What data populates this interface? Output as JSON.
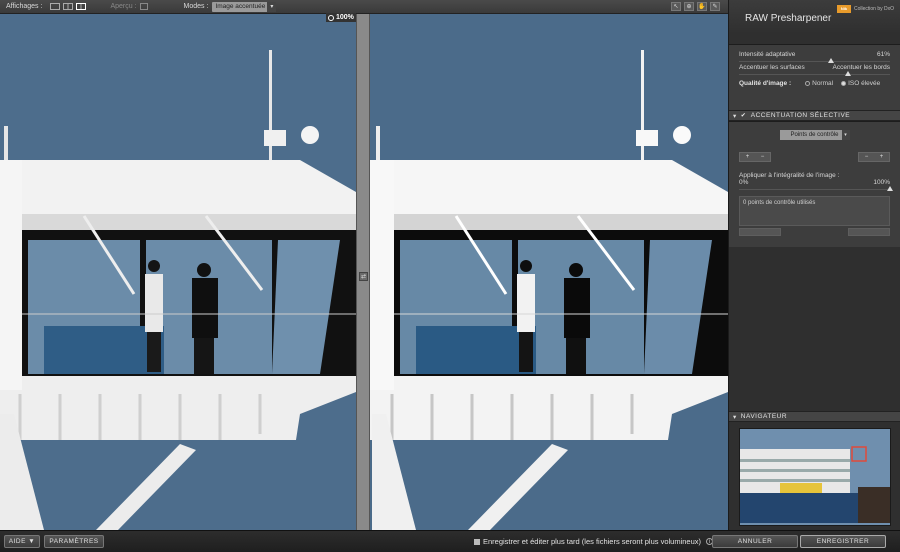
{
  "toolbar": {
    "affichages_label": "Affichages :",
    "apercu_label": "Aperçu :",
    "modes_label": "Modes :",
    "mode_value": "Image accentuée",
    "zoom": "100%"
  },
  "panel": {
    "title": "RAW Presharpener",
    "brand_logo": "Nik",
    "brand_text": "Collection by DxO",
    "intensity_label": "Intensité adaptative",
    "intensity_value": "61%",
    "intensity_level": 0.61,
    "surfaces_label": "Accentuer les surfaces",
    "bords_label": "Accentuer les bords",
    "quality_label": "Qualité d'image :",
    "quality_normal": "Normal",
    "quality_iso": "ISO élevée",
    "selective_title": "ACCENTUATION SÉLECTIVE",
    "control_points_select": "Points de contrôle",
    "apply_label": "Appliquer à l'intégralité de l'image :",
    "apply_min": "0%",
    "apply_max": "100%",
    "apply_level": 1.0,
    "points_used": "0 points de contrôle utilisés",
    "navigator_title": "NAVIGATEUR"
  },
  "bottom": {
    "help_label": "AIDE ▼",
    "params_label": "PARAMÈTRES",
    "save_later_label": "Enregistrer et éditer plus tard (les fichiers seront plus volumineux)",
    "cancel_label": "ANNULER",
    "save_label": "ENREGISTRER"
  }
}
